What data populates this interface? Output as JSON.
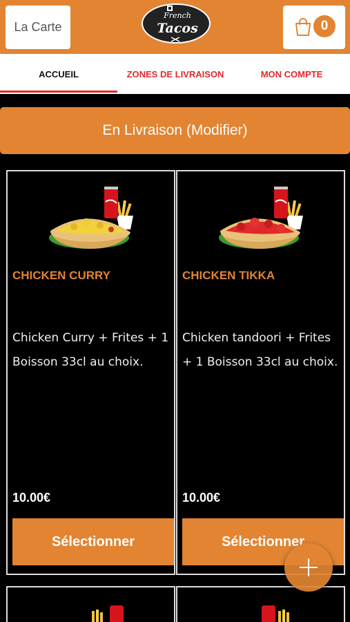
{
  "header": {
    "menu_label": "La Carte",
    "logo_text_top": "French",
    "logo_text_main": "Tacos",
    "cart_count": "0"
  },
  "tabs": [
    {
      "label": "ACCUEIL",
      "active": true
    },
    {
      "label": "ZONES DE LIVRAISON",
      "active": false
    },
    {
      "label": "MON COMPTE",
      "active": false
    }
  ],
  "delivery": {
    "label": "En Livraison (Modifier)"
  },
  "products": [
    {
      "name": "CHICKEN CURRY",
      "description": "Chicken Curry + Frites + 1 Boisson 33cl au choix.",
      "price": "10.00€",
      "button": "Sélectionner",
      "image": "tacos-curry-menu-image"
    },
    {
      "name": "CHICKEN TIKKA",
      "description": "Chicken tandoori + Frites + 1 Boisson 33cl au choix.",
      "price": "10.00€",
      "button": "Sélectionner",
      "image": "tacos-tikka-menu-image"
    }
  ],
  "fab": {
    "icon": "plus-icon"
  },
  "colors": {
    "accent": "#e28432",
    "tab_red": "#e0282c",
    "background": "#000000"
  }
}
